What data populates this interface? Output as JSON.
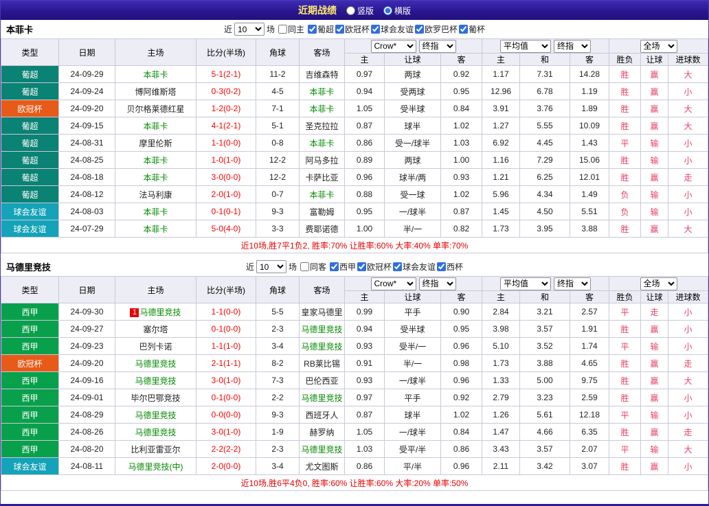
{
  "topbar": {
    "title": "近期战绩",
    "vertical": "竖版",
    "horizontal": "横版"
  },
  "headers": {
    "type": "类型",
    "date": "日期",
    "home": "主场",
    "score": "比分(半场)",
    "corner": "角球",
    "away": "客场",
    "crown_home": "主",
    "handicap": "让球",
    "crown_away": "客",
    "avg_home": "主",
    "avg_draw": "和",
    "avg_away": "客",
    "result": "胜负",
    "let_result": "让球",
    "goals": "进球数"
  },
  "league_colors": {
    "葡超": "#0a8274",
    "欧冠杯": "#e85a17",
    "球会友谊": "#14a3b8",
    "西甲": "#09a04c"
  },
  "colors": {
    "score": "#ff0000",
    "team_highlight": "#008800",
    "result_text": "#e83e63",
    "summary_text": "#e60000"
  },
  "sections": [
    {
      "team": "本菲卡",
      "filter": {
        "near": "近",
        "count": "10",
        "unit": "场",
        "same": "同主",
        "leagues": [
          "葡超",
          "欧冠杯",
          "球会友谊",
          "欧罗巴杯",
          "葡杯"
        ]
      },
      "selects": {
        "odds_company": "Crow*",
        "odds_final": "终指",
        "avg_type": "平均值",
        "avg_final": "终指",
        "scope": "全场"
      },
      "rows": [
        {
          "league": "葡超",
          "date": "24-09-29",
          "home": "本菲卡",
          "home_hl": true,
          "score": "5-1(2-1)",
          "corner": "11-2",
          "away": "吉维森特",
          "away_hl": false,
          "crown_home": "0.97",
          "handicap": "两球",
          "crown_away": "0.92",
          "avg_home": "1.17",
          "avg_draw": "7.31",
          "avg_away": "14.28",
          "result": "胜",
          "let_result": "赢",
          "goal_result": "大"
        },
        {
          "league": "葡超",
          "date": "24-09-24",
          "home": "博阿维斯塔",
          "home_hl": false,
          "score": "0-3(0-2)",
          "corner": "4-5",
          "away": "本菲卡",
          "away_hl": true,
          "crown_home": "0.94",
          "handicap": "受两球",
          "crown_away": "0.95",
          "avg_home": "12.96",
          "avg_draw": "6.78",
          "avg_away": "1.19",
          "result": "胜",
          "let_result": "赢",
          "goal_result": "小"
        },
        {
          "league": "欧冠杯",
          "date": "24-09-20",
          "home": "贝尔格莱德红星",
          "home_hl": false,
          "score": "1-2(0-2)",
          "corner": "7-1",
          "away": "本菲卡",
          "away_hl": true,
          "crown_home": "1.05",
          "handicap": "受半球",
          "crown_away": "0.84",
          "avg_home": "3.91",
          "avg_draw": "3.76",
          "avg_away": "1.89",
          "result": "胜",
          "let_result": "赢",
          "goal_result": "大"
        },
        {
          "league": "葡超",
          "date": "24-09-15",
          "home": "本菲卡",
          "home_hl": true,
          "score": "4-1(2-1)",
          "corner": "5-1",
          "away": "圣克拉拉",
          "away_hl": false,
          "crown_home": "0.87",
          "handicap": "球半",
          "crown_away": "1.02",
          "avg_home": "1.27",
          "avg_draw": "5.55",
          "avg_away": "10.09",
          "result": "胜",
          "let_result": "赢",
          "goal_result": "大"
        },
        {
          "league": "葡超",
          "date": "24-08-31",
          "home": "摩里伦斯",
          "home_hl": false,
          "score": "1-1(0-0)",
          "corner": "0-8",
          "away": "本菲卡",
          "away_hl": true,
          "crown_home": "0.86",
          "handicap": "受一/球半",
          "crown_away": "1.03",
          "avg_home": "6.92",
          "avg_draw": "4.45",
          "avg_away": "1.43",
          "result": "平",
          "let_result": "输",
          "goal_result": "小"
        },
        {
          "league": "葡超",
          "date": "24-08-25",
          "home": "本菲卡",
          "home_hl": true,
          "score": "1-0(1-0)",
          "corner": "12-2",
          "away": "阿马多拉",
          "away_hl": false,
          "crown_home": "0.89",
          "handicap": "两球",
          "crown_away": "1.00",
          "avg_home": "1.16",
          "avg_draw": "7.29",
          "avg_away": "15.06",
          "result": "胜",
          "let_result": "输",
          "goal_result": "小"
        },
        {
          "league": "葡超",
          "date": "24-08-18",
          "home": "本菲卡",
          "home_hl": true,
          "score": "3-0(0-0)",
          "corner": "12-2",
          "away": "卡萨比亚",
          "away_hl": false,
          "crown_home": "0.96",
          "handicap": "球半/两",
          "crown_away": "0.93",
          "avg_home": "1.21",
          "avg_draw": "6.25",
          "avg_away": "12.01",
          "result": "胜",
          "let_result": "赢",
          "goal_result": "走"
        },
        {
          "league": "葡超",
          "date": "24-08-12",
          "home": "法马利康",
          "home_hl": false,
          "score": "2-0(1-0)",
          "corner": "0-7",
          "away": "本菲卡",
          "away_hl": true,
          "crown_home": "0.88",
          "handicap": "受一球",
          "crown_away": "1.02",
          "avg_home": "5.96",
          "avg_draw": "4.34",
          "avg_away": "1.49",
          "result": "负",
          "let_result": "输",
          "goal_result": "小"
        },
        {
          "league": "球会友谊",
          "date": "24-08-03",
          "home": "本菲卡",
          "home_hl": true,
          "score": "0-1(0-1)",
          "corner": "9-3",
          "away": "富勒姆",
          "away_hl": false,
          "crown_home": "0.95",
          "handicap": "一/球半",
          "crown_away": "0.87",
          "avg_home": "1.45",
          "avg_draw": "4.50",
          "avg_away": "5.51",
          "result": "负",
          "let_result": "输",
          "goal_result": "小"
        },
        {
          "league": "球会友谊",
          "date": "24-07-29",
          "home": "本菲卡",
          "home_hl": true,
          "score": "5-0(4-0)",
          "corner": "3-3",
          "away": "费耶诺德",
          "away_hl": false,
          "crown_home": "1.00",
          "handicap": "半/一",
          "crown_away": "0.82",
          "avg_home": "1.73",
          "avg_draw": "3.95",
          "avg_away": "3.88",
          "result": "胜",
          "let_result": "赢",
          "goal_result": "大"
        }
      ],
      "summary": "近10场,胜7平1负2, 胜率:70% 让胜率:60% 大率:40% 单率:70%"
    },
    {
      "team": "马德里竞技",
      "filter": {
        "near": "近",
        "count": "10",
        "unit": "场",
        "same": "同客",
        "leagues": [
          "西甲",
          "欧冠杯",
          "球会友谊",
          "西杯"
        ]
      },
      "selects": {
        "odds_company": "Crow*",
        "odds_final": "终指",
        "avg_type": "平均值",
        "avg_final": "终指",
        "scope": "全场"
      },
      "rows": [
        {
          "league": "西甲",
          "date": "24-09-30",
          "home": "马德里竞技",
          "home_hl": true,
          "badge": "1",
          "score": "1-1(0-0)",
          "corner": "5-5",
          "away": "皇家马德里",
          "away_hl": false,
          "crown_home": "0.99",
          "handicap": "平手",
          "crown_away": "0.90",
          "avg_home": "2.84",
          "avg_draw": "3.21",
          "avg_away": "2.57",
          "result": "平",
          "let_result": "走",
          "goal_result": "小"
        },
        {
          "league": "西甲",
          "date": "24-09-27",
          "home": "塞尔塔",
          "home_hl": false,
          "score": "0-1(0-0)",
          "corner": "2-3",
          "away": "马德里竞技",
          "away_hl": true,
          "crown_home": "0.94",
          "handicap": "受半球",
          "crown_away": "0.95",
          "avg_home": "3.98",
          "avg_draw": "3.57",
          "avg_away": "1.91",
          "result": "胜",
          "let_result": "赢",
          "goal_result": "小"
        },
        {
          "league": "西甲",
          "date": "24-09-23",
          "home": "巴列卡诺",
          "home_hl": false,
          "score": "1-1(1-0)",
          "corner": "3-4",
          "away": "马德里竞技",
          "away_hl": true,
          "crown_home": "0.93",
          "handicap": "受半/一",
          "crown_away": "0.96",
          "avg_home": "5.10",
          "avg_draw": "3.52",
          "avg_away": "1.74",
          "result": "平",
          "let_result": "输",
          "goal_result": "小"
        },
        {
          "league": "欧冠杯",
          "date": "24-09-20",
          "home": "马德里竞技",
          "home_hl": true,
          "score": "2-1(1-1)",
          "corner": "8-2",
          "away": "RB莱比锡",
          "away_hl": false,
          "crown_home": "0.91",
          "handicap": "半/一",
          "crown_away": "0.98",
          "avg_home": "1.73",
          "avg_draw": "3.88",
          "avg_away": "4.65",
          "result": "胜",
          "let_result": "赢",
          "goal_result": "走"
        },
        {
          "league": "西甲",
          "date": "24-09-16",
          "home": "马德里竞技",
          "home_hl": true,
          "score": "3-0(1-0)",
          "corner": "7-3",
          "away": "巴伦西亚",
          "away_hl": false,
          "crown_home": "0.93",
          "handicap": "一/球半",
          "crown_away": "0.96",
          "avg_home": "1.33",
          "avg_draw": "5.00",
          "avg_away": "9.75",
          "result": "胜",
          "let_result": "赢",
          "goal_result": "大"
        },
        {
          "league": "西甲",
          "date": "24-09-01",
          "home": "毕尔巴鄂竞技",
          "home_hl": false,
          "score": "0-1(0-0)",
          "corner": "2-2",
          "away": "马德里竞技",
          "away_hl": true,
          "crown_home": "0.97",
          "handicap": "平手",
          "crown_away": "0.92",
          "avg_home": "2.79",
          "avg_draw": "3.23",
          "avg_away": "2.59",
          "result": "胜",
          "let_result": "赢",
          "goal_result": "小"
        },
        {
          "league": "西甲",
          "date": "24-08-29",
          "home": "马德里竞技",
          "home_hl": true,
          "score": "0-0(0-0)",
          "corner": "9-3",
          "away": "西班牙人",
          "away_hl": false,
          "crown_home": "0.87",
          "handicap": "球半",
          "crown_away": "1.02",
          "avg_home": "1.26",
          "avg_draw": "5.61",
          "avg_away": "12.18",
          "result": "平",
          "let_result": "输",
          "goal_result": "小"
        },
        {
          "league": "西甲",
          "date": "24-08-26",
          "home": "马德里竞技",
          "home_hl": true,
          "score": "3-0(1-0)",
          "corner": "1-9",
          "away": "赫罗纳",
          "away_hl": false,
          "crown_home": "1.05",
          "handicap": "一/球半",
          "crown_away": "0.84",
          "avg_home": "1.47",
          "avg_draw": "4.66",
          "avg_away": "6.35",
          "result": "胜",
          "let_result": "赢",
          "goal_result": "走"
        },
        {
          "league": "西甲",
          "date": "24-08-20",
          "home": "比利亚雷亚尔",
          "home_hl": false,
          "score": "2-2(2-2)",
          "corner": "2-3",
          "away": "马德里竞技",
          "away_hl": true,
          "crown_home": "1.03",
          "handicap": "受平/半",
          "crown_away": "0.86",
          "avg_home": "3.43",
          "avg_draw": "3.57",
          "avg_away": "2.07",
          "result": "平",
          "let_result": "输",
          "goal_result": "大"
        },
        {
          "league": "球会友谊",
          "date": "24-08-11",
          "home": "马德里竞技(中)",
          "home_hl": true,
          "score": "2-0(0-0)",
          "corner": "3-4",
          "away": "尤文图斯",
          "away_hl": false,
          "crown_home": "0.86",
          "handicap": "平/半",
          "crown_away": "0.96",
          "avg_home": "2.11",
          "avg_draw": "3.42",
          "avg_away": "3.07",
          "result": "胜",
          "let_result": "赢",
          "goal_result": "小"
        }
      ],
      "summary": "近10场,胜6平4负0, 胜率:60% 让胜率:60% 大率:20% 单率:50%"
    }
  ]
}
